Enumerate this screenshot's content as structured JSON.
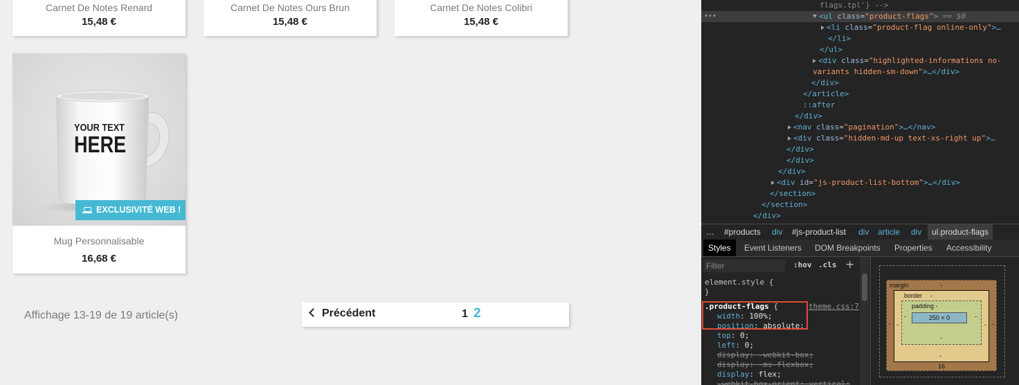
{
  "shop": {
    "top_products": [
      {
        "name": "Carnet De Notes Renard",
        "price": "15,48 €"
      },
      {
        "name": "Carnet De Notes Ours Brun",
        "price": "15,48 €"
      },
      {
        "name": "Carnet De Notes Colibri",
        "price": "15,48 €"
      }
    ],
    "mug": {
      "image_text_1": "YOUR TEXT",
      "image_text_2": "HERE",
      "flag": "EXCLUSIVITÉ WEB !",
      "name": "Mug Personnalisable",
      "price": "16,68 €"
    },
    "count_text": "Affichage 13-19 de 19 article(s)",
    "pagination": {
      "prev": "Précédent",
      "page1": "1",
      "page2": "2"
    },
    "colors": {
      "accent": "#45b9d3",
      "price": "#232323"
    }
  },
  "devtools": {
    "more_icon": "ellipsis-icon",
    "dom": {
      "l0": {
        "comment": "flags.tpl'} -->"
      },
      "l1": {
        "tag_open": "<ul",
        "attr": "class",
        "val": "\"product-flags\"",
        "close": ">",
        "marker": " == $0"
      },
      "l2": {
        "tag_open": "<li",
        "attr": "class",
        "val": "\"product-flag online-only\"",
        "rest": ">…"
      },
      "l3": {
        "tag": "</li>"
      },
      "l4": {
        "tag": "</ul>"
      },
      "l5": {
        "tag_open": "<div",
        "attr": "class",
        "val": "\"highlighted-informations no-"
      },
      "l6": {
        "val": "variants hidden-sm-down\"",
        "rest": ">…</div>"
      },
      "l7": {
        "tag": "</div>"
      },
      "l8": {
        "tag": "</article>"
      },
      "l9": {
        "text": "::after"
      },
      "l10": {
        "tag": "</div>"
      },
      "l11": {
        "tag_open": "<nav",
        "attr": "class",
        "val": "\"pagination\"",
        "rest": ">…</nav>"
      },
      "l12": {
        "tag_open": "<div",
        "attr": "class",
        "val": "\"hidden-md-up text-xs-right up\"",
        "rest": ">…"
      },
      "l13": {
        "tag": "</div>"
      },
      "l14": {
        "tag": "</div>"
      },
      "l15": {
        "tag": "</div>"
      },
      "l16": {
        "tag_open": "<div",
        "attr": "id",
        "val": "\"js-product-list-bottom\"",
        "rest": ">…</div>"
      },
      "l17": {
        "tag": "</section>"
      },
      "l18": {
        "tag": "</section>"
      },
      "l19": {
        "tag": "</div>"
      }
    },
    "breadcrumbs": [
      "…",
      "#products",
      "div",
      "#js-product-list",
      "div",
      "article",
      "div",
      "ul.product-flags"
    ],
    "tabs": [
      "Styles",
      "Event Listeners",
      "DOM Breakpoints",
      "Properties",
      "Accessibility"
    ],
    "styles": {
      "filter_placeholder": "Filter",
      "hov": ":hov",
      "cls": ".cls",
      "plus": "+",
      "element_style": "element.style {",
      "close_brace": "}",
      "selector": ".product-flags",
      "open_brace": " {",
      "source": "theme.css:7",
      "rules": [
        {
          "prop": "width",
          "val": "100%;",
          "struck": false
        },
        {
          "prop": "position",
          "val": "absolute;",
          "struck": false
        },
        {
          "prop": "top",
          "val": "0;",
          "struck": false
        },
        {
          "prop": "left",
          "val": "0;",
          "struck": false
        },
        {
          "prop": "display",
          "val": "-webkit-box;",
          "struck": true
        },
        {
          "prop": "display",
          "val": "-ms-flexbox;",
          "struck": true
        },
        {
          "prop": "display",
          "val": "flex;",
          "struck": false
        },
        {
          "prop": "-webkit-box-orient",
          "val": "vertical;",
          "struck": true
        }
      ]
    },
    "box_model": {
      "margin_label": "margin",
      "margin_top": "-",
      "margin_left": "-",
      "margin_right": "-",
      "margin_bottom": "16",
      "border_label": "border",
      "border_top": "-",
      "border_left": "-",
      "border_right": "-",
      "border_bottom": "-",
      "padding_label": "padding -",
      "padding_left": "-",
      "padding_right": "-",
      "padding_bottom": "-",
      "content": "250 × 0"
    }
  }
}
